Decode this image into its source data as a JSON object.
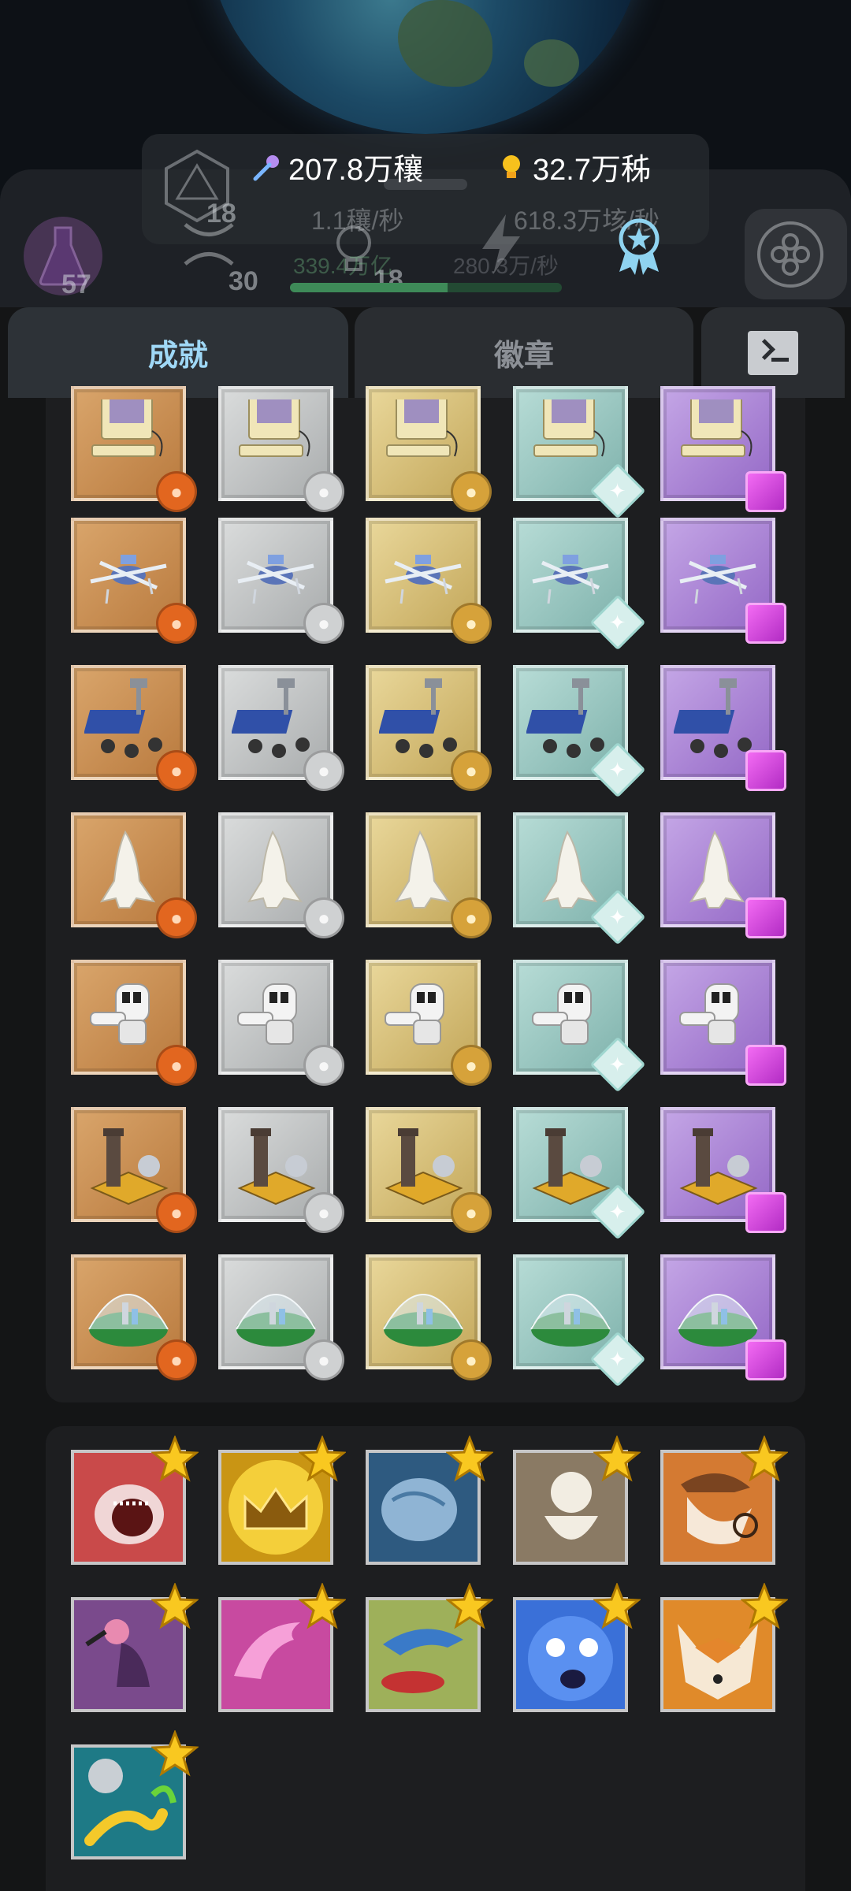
{
  "hud": {
    "research_amount": "207.8万穰",
    "research_rate": "1.1穰/秒",
    "idea_amount": "32.7万秭",
    "idea_rate": "618.3万垓/秒",
    "dice_count": "18",
    "dna_count": "30",
    "idea_level": "18",
    "flask_count": "57",
    "green_amount": "339.4万亿",
    "energy_rate": "280.3万/秒",
    "progress": 0.58
  },
  "tabs": {
    "achievements": "成就",
    "badges": "徽章",
    "terminal_icon": "terminal-icon"
  },
  "achievement_rows": [
    {
      "name": "computer",
      "icon": "computer-icon"
    },
    {
      "name": "drone",
      "icon": "drone-icon"
    },
    {
      "name": "rover",
      "icon": "rover-icon"
    },
    {
      "name": "shuttle",
      "icon": "shuttle-icon"
    },
    {
      "name": "astronaut",
      "icon": "astronaut-icon"
    },
    {
      "name": "launch-base",
      "icon": "launch-base-icon"
    },
    {
      "name": "dome-colony",
      "icon": "dome-colony-icon"
    }
  ],
  "tiers": [
    "bronze",
    "silver",
    "gold",
    "diamond",
    "purple"
  ],
  "badges": [
    {
      "name": "shark",
      "icon": "shark-icon"
    },
    {
      "name": "crown",
      "icon": "crown-icon"
    },
    {
      "name": "fist",
      "icon": "fist-icon"
    },
    {
      "name": "darwin",
      "icon": "darwin-icon"
    },
    {
      "name": "detective-dino",
      "icon": "detective-dino-icon"
    },
    {
      "name": "bird",
      "icon": "bird-icon"
    },
    {
      "name": "dolphin",
      "icon": "dolphin-icon"
    },
    {
      "name": "dino-bird",
      "icon": "dino-bird-icon"
    },
    {
      "name": "blue-creature",
      "icon": "blue-creature-icon"
    },
    {
      "name": "fox",
      "icon": "fox-icon"
    },
    {
      "name": "worms",
      "icon": "worms-icon"
    }
  ]
}
